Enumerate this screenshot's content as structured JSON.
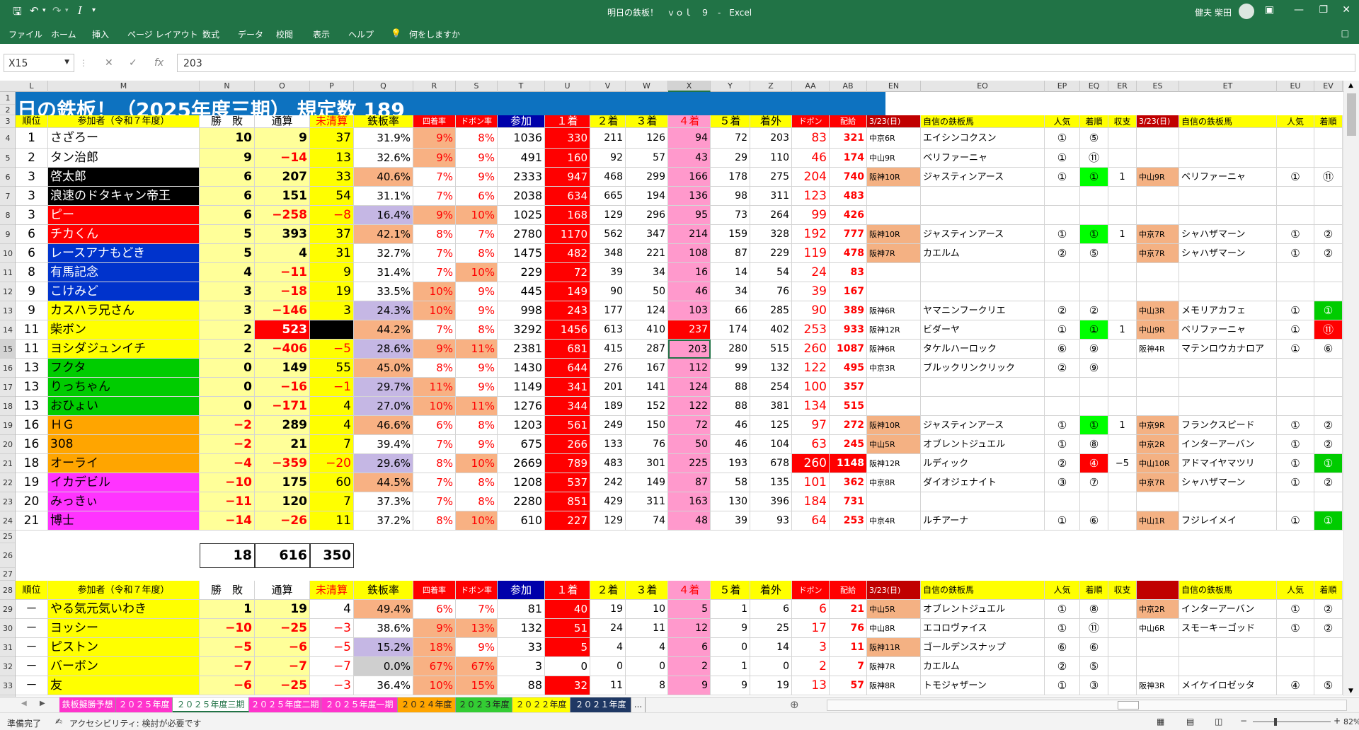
{
  "app": {
    "title": "明日の鉄板！　ｖｏｌ　９　-　Excel",
    "user": "健夫 柴田"
  },
  "menu": [
    "ファイル",
    "ホーム",
    "挿入",
    "ページ レイアウト",
    "数式",
    "データ",
    "校閲",
    "表示",
    "ヘルプ",
    "何をしますか"
  ],
  "formula_bar": {
    "name_box": "X15",
    "value": "203"
  },
  "columns": [
    "L",
    "M",
    "N",
    "O",
    "P",
    "Q",
    "R",
    "S",
    "T",
    "U",
    "V",
    "W",
    "X",
    "Y",
    "Z",
    "AA",
    "AB",
    "EN",
    "EO",
    "EP",
    "EQ",
    "ER",
    "ES",
    "ET",
    "EU",
    "EV"
  ],
  "rows": [
    "1",
    "2",
    "3",
    "4",
    "5",
    "6",
    "7",
    "8",
    "9",
    "10",
    "11",
    "12",
    "13",
    "14",
    "15",
    "16",
    "17",
    "18",
    "19",
    "20",
    "21",
    "22",
    "23",
    "24",
    "25",
    "26",
    "27",
    "28",
    "29",
    "30",
    "31",
    "32",
    "33"
  ],
  "banner": "日の鉄板！（2025年度三期）  規定数  189",
  "header": [
    "順位",
    "参加者（令和７年度）",
    "勝　敗",
    "通算",
    "未清算",
    "鉄板率",
    "四着率",
    "ドボン率",
    "参加",
    "１着",
    "２着",
    "３着",
    "４着",
    "５着",
    "着外",
    "ドボン",
    "配給",
    "3/23(日)",
    "自信の鉄板馬",
    "人気",
    "着順",
    "収支",
    "3/23(日)",
    "自信の鉄板馬",
    "人気",
    "着順"
  ],
  "header2": [
    "順位",
    "参加者（令和７年度）",
    "勝　敗",
    "通算",
    "未清算",
    "鉄板率",
    "四着率",
    "ドボン率",
    "参加",
    "１着",
    "２着",
    "３着",
    "４着",
    "５着",
    "着外",
    "ドボン",
    "配給",
    "3/23(日)",
    "自信の鉄板馬",
    "人気",
    "着順",
    "収支",
    "",
    "自信の鉄板馬",
    "人気",
    "着順"
  ],
  "main_rows": [
    [
      "1",
      "さざろー",
      "10",
      "9",
      "37",
      "31.9%",
      "9%",
      "8%",
      "1036",
      "330",
      "211",
      "126",
      "94",
      "72",
      "203",
      "83",
      "321",
      "中京6R",
      "エイシンコクスン",
      "①",
      "⑤",
      "",
      "",
      "",
      "",
      ""
    ],
    [
      "2",
      "タン治郎",
      "9",
      "−14",
      "13",
      "32.6%",
      "9%",
      "9%",
      "491",
      "160",
      "92",
      "57",
      "43",
      "29",
      "110",
      "46",
      "174",
      "中山9R",
      "ベリファーニャ",
      "①",
      "⑪",
      "",
      "",
      "",
      "",
      ""
    ],
    [
      "3",
      "啓太郎",
      "6",
      "207",
      "33",
      "40.6%",
      "7%",
      "9%",
      "2333",
      "947",
      "468",
      "299",
      "166",
      "178",
      "275",
      "204",
      "740",
      "阪神10R",
      "ジャスティンアース",
      "①",
      "①",
      "1",
      "中山9R",
      "ベリファーニャ",
      "①",
      "⑪"
    ],
    [
      "3",
      "浪速のドタキャン帝王",
      "6",
      "151",
      "54",
      "31.1%",
      "7%",
      "6%",
      "2038",
      "634",
      "665",
      "194",
      "136",
      "98",
      "311",
      "123",
      "483",
      "",
      "",
      "",
      "",
      "",
      "",
      "",
      "",
      ""
    ],
    [
      "3",
      "ピー",
      "6",
      "−258",
      "−8",
      "16.4%",
      "9%",
      "10%",
      "1025",
      "168",
      "129",
      "296",
      "95",
      "73",
      "264",
      "99",
      "426",
      "",
      "",
      "",
      "",
      "",
      "",
      "",
      "",
      ""
    ],
    [
      "6",
      "チカくん",
      "5",
      "393",
      "37",
      "42.1%",
      "8%",
      "7%",
      "2780",
      "1170",
      "562",
      "347",
      "214",
      "159",
      "328",
      "192",
      "777",
      "阪神10R",
      "ジャスティンアース",
      "①",
      "①",
      "1",
      "中京7R",
      "シャハザマーン",
      "①",
      "②"
    ],
    [
      "6",
      "レースアナもどき",
      "5",
      "4",
      "31",
      "32.7%",
      "7%",
      "8%",
      "1475",
      "482",
      "348",
      "221",
      "108",
      "87",
      "229",
      "119",
      "478",
      "阪神7R",
      "カエルム",
      "②",
      "⑤",
      "",
      "中京7R",
      "シャハザマーン",
      "①",
      "②"
    ],
    [
      "8",
      "有馬記念",
      "4",
      "−11",
      "9",
      "31.4%",
      "7%",
      "10%",
      "229",
      "72",
      "39",
      "34",
      "16",
      "14",
      "54",
      "24",
      "83",
      "",
      "",
      "",
      "",
      "",
      "",
      "",
      "",
      ""
    ],
    [
      "9",
      "こけみど",
      "3",
      "−18",
      "19",
      "33.5%",
      "10%",
      "9%",
      "445",
      "149",
      "90",
      "50",
      "46",
      "34",
      "76",
      "39",
      "167",
      "",
      "",
      "",
      "",
      "",
      "",
      "",
      "",
      ""
    ],
    [
      "9",
      "カスハラ兄さん",
      "3",
      "−146",
      "3",
      "24.3%",
      "10%",
      "9%",
      "998",
      "243",
      "177",
      "124",
      "103",
      "66",
      "285",
      "90",
      "389",
      "阪神6R",
      "ヤマニンフークリエ",
      "②",
      "②",
      "",
      "中山3R",
      "メモリアカフェ",
      "①",
      "①"
    ],
    [
      "11",
      "柴ボン",
      "2",
      "523",
      "",
      "44.2%",
      "7%",
      "8%",
      "3292",
      "1456",
      "613",
      "410",
      "237",
      "174",
      "402",
      "253",
      "933",
      "阪神12R",
      "ビダーヤ",
      "①",
      "①",
      "1",
      "中山9R",
      "ベリファーニャ",
      "①",
      "⑪"
    ],
    [
      "11",
      "ヨシダジュンイチ",
      "2",
      "−406",
      "−5",
      "28.6%",
      "9%",
      "11%",
      "2381",
      "681",
      "415",
      "287",
      "203",
      "280",
      "515",
      "260",
      "1087",
      "阪神6R",
      "タケルハーロック",
      "⑥",
      "⑨",
      "",
      "阪神4R",
      "マテンロウカナロア",
      "①",
      "⑥"
    ],
    [
      "13",
      "フクタ",
      "0",
      "149",
      "55",
      "45.0%",
      "8%",
      "9%",
      "1430",
      "644",
      "276",
      "167",
      "112",
      "99",
      "132",
      "122",
      "495",
      "中京3R",
      "ブルックリンクリック",
      "②",
      "⑨",
      "",
      "",
      "",
      "",
      ""
    ],
    [
      "13",
      "りっちゃん",
      "0",
      "−16",
      "−1",
      "29.7%",
      "11%",
      "9%",
      "1149",
      "341",
      "201",
      "141",
      "124",
      "88",
      "254",
      "100",
      "357",
      "",
      "",
      "",
      "",
      "",
      "",
      "",
      "",
      ""
    ],
    [
      "13",
      "おひょい",
      "0",
      "−171",
      "4",
      "27.0%",
      "10%",
      "11%",
      "1276",
      "344",
      "189",
      "152",
      "122",
      "88",
      "381",
      "134",
      "515",
      "",
      "",
      "",
      "",
      "",
      "",
      "",
      "",
      ""
    ],
    [
      "16",
      "ＨＧ",
      "−2",
      "289",
      "4",
      "46.6%",
      "6%",
      "8%",
      "1203",
      "561",
      "249",
      "150",
      "72",
      "46",
      "125",
      "97",
      "272",
      "阪神10R",
      "ジャスティンアース",
      "①",
      "①",
      "1",
      "中京9R",
      "フランクスピード",
      "①",
      "②"
    ],
    [
      "16",
      "308",
      "−2",
      "21",
      "7",
      "39.4%",
      "7%",
      "9%",
      "675",
      "266",
      "133",
      "76",
      "50",
      "46",
      "104",
      "63",
      "245",
      "中山5R",
      "オブレントジュエル",
      "①",
      "⑧",
      "",
      "中京2R",
      "インターアーバン",
      "①",
      "②"
    ],
    [
      "18",
      "オーライ",
      "−4",
      "−359",
      "−20",
      "29.6%",
      "8%",
      "10%",
      "2669",
      "789",
      "483",
      "301",
      "225",
      "193",
      "678",
      "260",
      "1148",
      "阪神12R",
      "ルディック",
      "②",
      "④",
      "−5",
      "中山10R",
      "アドマイヤマツリ",
      "①",
      "①"
    ],
    [
      "19",
      "イカデビル",
      "−10",
      "175",
      "60",
      "44.5%",
      "7%",
      "8%",
      "1208",
      "537",
      "242",
      "149",
      "87",
      "58",
      "135",
      "101",
      "362",
      "中京8R",
      "ダイオジェナイト",
      "③",
      "⑦",
      "",
      "中京7R",
      "シャハザマーン",
      "①",
      "②"
    ],
    [
      "20",
      "みっきぃ",
      "−11",
      "120",
      "7",
      "37.3%",
      "7%",
      "8%",
      "2280",
      "851",
      "429",
      "311",
      "163",
      "130",
      "396",
      "184",
      "731",
      "",
      "",
      "",
      "",
      "",
      "",
      "",
      "",
      ""
    ],
    [
      "21",
      "博士",
      "−14",
      "−26",
      "11",
      "37.2%",
      "8%",
      "10%",
      "610",
      "227",
      "129",
      "74",
      "48",
      "39",
      "93",
      "64",
      "253",
      "中京4R",
      "ルチアーナ",
      "①",
      "⑥",
      "",
      "中山1R",
      "フジレイメイ",
      "①",
      "①"
    ]
  ],
  "totals": [
    "18",
    "616",
    "350"
  ],
  "sub_rows": [
    [
      "－",
      "やる気元気いわき",
      "1",
      "19",
      "4",
      "49.4%",
      "6%",
      "7%",
      "81",
      "40",
      "19",
      "10",
      "5",
      "1",
      "6",
      "6",
      "21",
      "中山5R",
      "オブレントジュエル",
      "①",
      "⑧",
      "",
      "中京2R",
      "インターアーバン",
      "①",
      "②"
    ],
    [
      "－",
      "ヨッシー",
      "−10",
      "−25",
      "−3",
      "38.6%",
      "9%",
      "13%",
      "132",
      "51",
      "24",
      "11",
      "12",
      "9",
      "25",
      "17",
      "76",
      "中山8R",
      "エコロヴァイス",
      "①",
      "⑪",
      "",
      "中山6R",
      "スモーキーゴッド",
      "①",
      "②"
    ],
    [
      "－",
      "ピストン",
      "−5",
      "−6",
      "−5",
      "15.2%",
      "18%",
      "9%",
      "33",
      "5",
      "4",
      "4",
      "6",
      "0",
      "14",
      "3",
      "11",
      "阪神11R",
      "ゴールデンスナップ",
      "⑥",
      "⑥",
      "",
      "",
      "",
      "",
      ""
    ],
    [
      "－",
      "バーボン",
      "−7",
      "−7",
      "−7",
      "0.0%",
      "67%",
      "67%",
      "3",
      "0",
      "0",
      "0",
      "2",
      "1",
      "0",
      "2",
      "7",
      "阪神7R",
      "カエルム",
      "②",
      "⑤",
      "",
      "",
      "",
      "",
      ""
    ],
    [
      "－",
      "友",
      "−6",
      "−25",
      "−3",
      "36.4%",
      "10%",
      "15%",
      "88",
      "32",
      "11",
      "8",
      "9",
      "9",
      "19",
      "13",
      "57",
      "阪神8R",
      "トモジャザーン",
      "①",
      "③",
      "",
      "阪神3R",
      "メイケイロゼッタ",
      "④",
      "⑤"
    ]
  ],
  "sheet_tabs": [
    "鉄板擬勝予想",
    "２０２５年度",
    "２０２５年度三期",
    "２０２５年度二期",
    "２０２５年度一期",
    "２０２４年度",
    "２０２３年度",
    "２０２２年度",
    "２０２１年度",
    "..."
  ],
  "tab_colors": [
    "#ff33cc",
    "#ff33cc",
    "#ffffff",
    "#ff33cc",
    "#ff33cc",
    "#ffa500",
    "#33cc33",
    "#ffff00",
    "#1f3864",
    "#f3f3f3"
  ],
  "status": {
    "ready": "準備完了",
    "accessibility": "アクセシビリティ: 検討が必要です",
    "zoom": "82%"
  },
  "colors": {
    "excel_green": "#217346",
    "banner_blue": "#0d72c0",
    "header_yellow": "#ffff00",
    "red": "#ff0000",
    "pink": "#ff99cc"
  }
}
